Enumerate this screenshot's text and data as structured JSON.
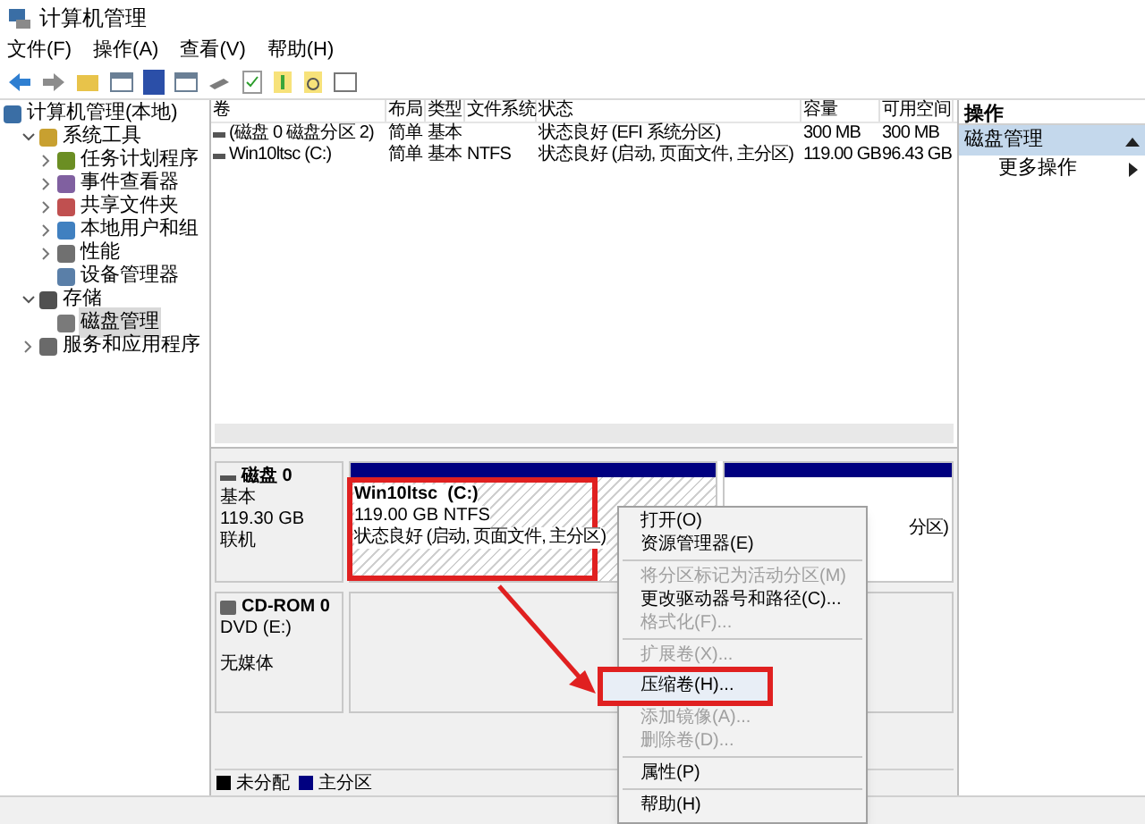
{
  "window": {
    "title": "计算机管理"
  },
  "menu_bar": [
    "文件(F)",
    "操作(A)",
    "查看(V)",
    "帮助(H)"
  ],
  "tree": [
    {
      "label": "计算机管理(本地)",
      "selected": false,
      "children": [
        {
          "label": "系统工具",
          "selected": false,
          "expanded": true,
          "children": [
            {
              "label": "任务计划程序",
              "selected": false,
              "expanded": false
            },
            {
              "label": "事件查看器",
              "selected": false,
              "expanded": false
            },
            {
              "label": "共享文件夹",
              "selected": false,
              "expanded": false
            },
            {
              "label": "本地用户和组",
              "selected": false,
              "expanded": false
            },
            {
              "label": "性能",
              "selected": false,
              "expanded": false
            },
            {
              "label": "设备管理器",
              "selected": false
            }
          ]
        },
        {
          "label": "存储",
          "selected": false,
          "expanded": true,
          "children": [
            {
              "label": "磁盘管理",
              "selected": true
            }
          ]
        },
        {
          "label": "服务和应用程序",
          "selected": false,
          "expanded": false
        }
      ]
    }
  ],
  "volume_table": {
    "columns": [
      "卷",
      "布局",
      "类型",
      "文件系统",
      "状态",
      "容量",
      "可用空间"
    ],
    "rows": [
      [
        "(磁盘 0 磁盘分区 2)",
        "简单",
        "基本",
        "",
        "状态良好 (EFI 系统分区)",
        "300 MB",
        "300 MB"
      ],
      [
        "Win10ltsc (C:)",
        "简单",
        "基本",
        "NTFS",
        "状态良好 (启动, 页面文件, 主分区)",
        "119.00 GB",
        "96.43 GB"
      ]
    ]
  },
  "disks": [
    {
      "kind": "disk",
      "name": "磁盘 0",
      "type": "基本",
      "size": "119.30 GB",
      "status": "联机",
      "partitions": [
        {
          "name": "Win10ltsc  (C:)",
          "size": "119.00 GB NTFS",
          "status": "状态良好 (启动, 页面文件, 主分区)",
          "selected": true
        },
        {
          "status": "分区)",
          "selected": false
        }
      ]
    },
    {
      "kind": "cdrom",
      "name": "CD-ROM 0",
      "type": "DVD (E:)",
      "status": "无媒体"
    }
  ],
  "legend": [
    {
      "label": "未分配",
      "color": "#000000"
    },
    {
      "label": "主分区",
      "color": "#000080"
    }
  ],
  "actions": {
    "title": "操作",
    "section": "磁盘管理",
    "items": [
      "更多操作"
    ]
  },
  "context_menu": [
    {
      "label": "打开(O)",
      "disabled": false,
      "separator_before": false,
      "highlighted": false
    },
    {
      "label": "资源管理器(E)",
      "disabled": false,
      "separator_before": false,
      "highlighted": false
    },
    {
      "label": "将分区标记为活动分区(M)",
      "disabled": true,
      "separator_before": true,
      "highlighted": false
    },
    {
      "label": "更改驱动器号和路径(C)...",
      "disabled": false,
      "separator_before": false,
      "highlighted": false
    },
    {
      "label": "格式化(F)...",
      "disabled": true,
      "separator_before": false,
      "highlighted": false
    },
    {
      "label": "扩展卷(X)...",
      "disabled": true,
      "separator_before": true,
      "highlighted": false
    },
    {
      "label": "压缩卷(H)...",
      "disabled": false,
      "separator_before": false,
      "highlighted": true
    },
    {
      "label": "添加镜像(A)...",
      "disabled": true,
      "separator_before": false,
      "highlighted": false
    },
    {
      "label": "删除卷(D)...",
      "disabled": true,
      "separator_before": false,
      "highlighted": false
    },
    {
      "label": "属性(P)",
      "disabled": false,
      "separator_before": true,
      "highlighted": false
    },
    {
      "label": "帮助(H)",
      "disabled": false,
      "separator_before": true,
      "highlighted": false
    }
  ]
}
